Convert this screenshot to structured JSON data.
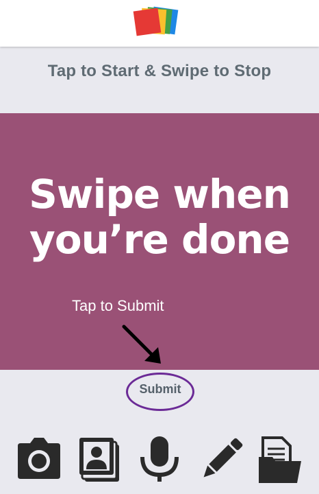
{
  "header": {
    "logo_icon": "stacked-colored-cards-logo",
    "logo_colors": [
      "#e53935",
      "#fbc02d",
      "#43a047",
      "#1e88e5"
    ]
  },
  "instruction": "Tap to Start & Swipe to Stop",
  "panel": {
    "background": "#9a5176",
    "headline_line1": "Swipe when",
    "headline_line2": "you’re done",
    "hint": "Tap to Submit",
    "arrow_icon": "arrow-down-right-icon"
  },
  "submit": {
    "label": "Submit",
    "ring_color": "#6b2a96"
  },
  "toolbar": {
    "items": [
      {
        "icon": "camera-icon"
      },
      {
        "icon": "photo-gallery-icon"
      },
      {
        "icon": "microphone-icon"
      },
      {
        "icon": "pencil-icon"
      },
      {
        "icon": "file-folder-icon"
      }
    ],
    "icon_color": "#2a2a2a"
  }
}
